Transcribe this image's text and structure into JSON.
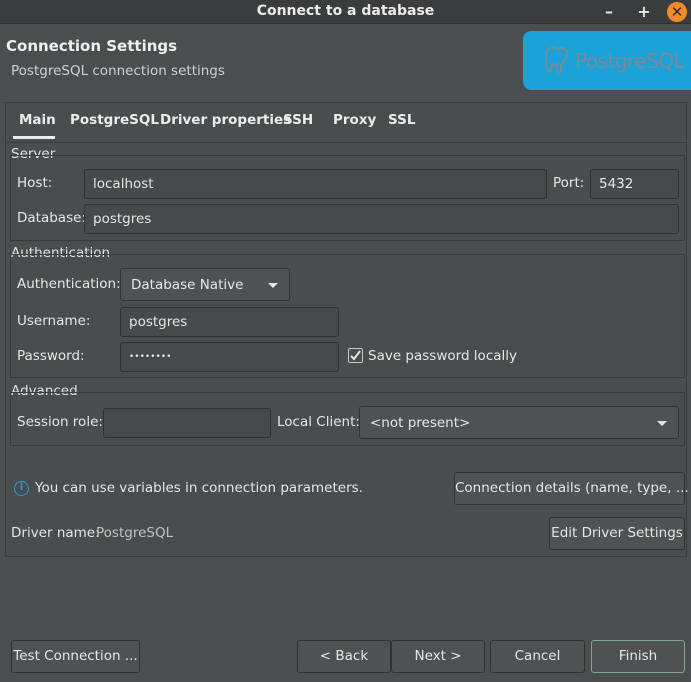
{
  "window": {
    "title": "Connect to a database",
    "minimize": "–",
    "maximize": "+",
    "close": "✕"
  },
  "header": {
    "title": "Connection Settings",
    "subtitle": "PostgreSQL connection settings",
    "logo_text": "PostgreSQL"
  },
  "tabs": [
    {
      "label": "Main",
      "active": true
    },
    {
      "label": "PostgreSQL"
    },
    {
      "label": "Driver properties"
    },
    {
      "label": "SSH"
    },
    {
      "label": "Proxy"
    },
    {
      "label": "SSL"
    }
  ],
  "server": {
    "group_label": "Server",
    "host_label": "Host:",
    "host_value": "localhost",
    "port_label": "Port:",
    "port_value": "5432",
    "database_label": "Database:",
    "database_value": "postgres"
  },
  "auth": {
    "group_label": "Authentication",
    "auth_label": "Authentication:",
    "auth_value": "Database Native",
    "username_label": "Username:",
    "username_value": "postgres",
    "password_label": "Password:",
    "password_value": "••••••••",
    "save_password_label": "Save password locally",
    "save_password_checked": true
  },
  "advanced": {
    "group_label": "Advanced",
    "session_role_label": "Session role:",
    "session_role_value": "",
    "local_client_label": "Local Client:",
    "local_client_value": "<not present>"
  },
  "info": {
    "text": "You can use variables in connection parameters.",
    "connection_details_button": "Connection details (name, type, ... )"
  },
  "driver": {
    "label": "Driver name:",
    "value": "PostgreSQL",
    "edit_button": "Edit Driver Settings"
  },
  "footer": {
    "test_connection": "Test Connection ...",
    "back": "< Back",
    "next": "Next >",
    "cancel": "Cancel",
    "finish": "Finish"
  },
  "colors": {
    "background": "#4b4e4f",
    "titlebar": "#3a3c3d",
    "logo_bg": "#1ba2d8",
    "close_button": "#f58a28",
    "info_icon": "#2f9bd6",
    "finish_border": "#7fa98a"
  }
}
